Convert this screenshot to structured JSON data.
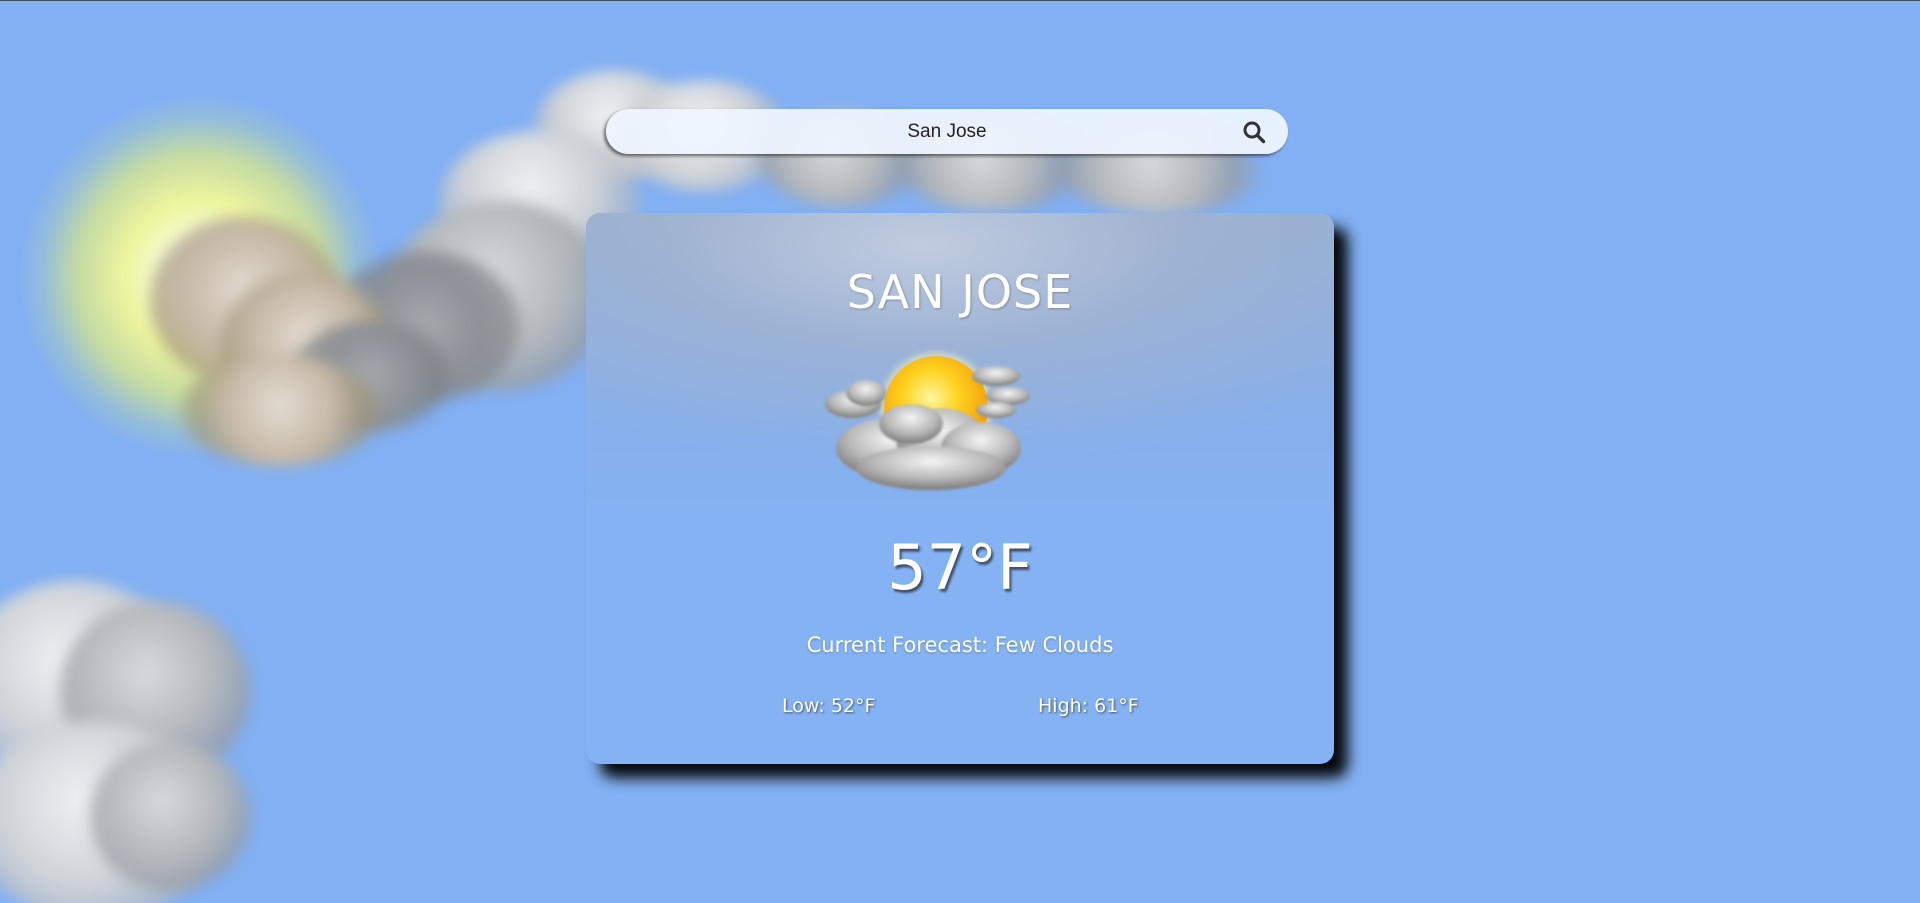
{
  "search": {
    "value": "San Jose",
    "icon": "search-icon"
  },
  "weather": {
    "city": "SAN JOSE",
    "icon": "few-clouds-icon",
    "temperature": "57°F",
    "forecast": "Current Forecast: Few Clouds",
    "low": "Low: 52°F",
    "high": "High: 61°F"
  },
  "background": {
    "sky_color": "#82b0f3",
    "scene": "sun-with-clouds"
  }
}
